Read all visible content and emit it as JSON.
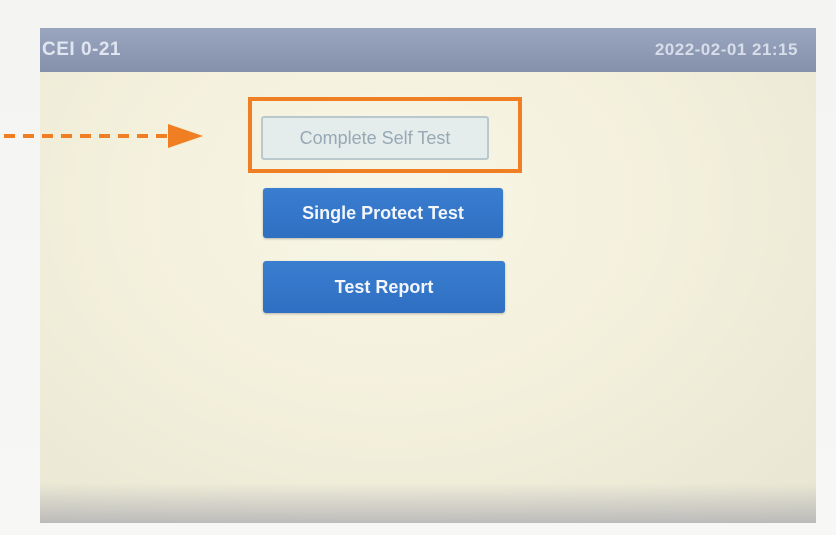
{
  "title_bar": {
    "left_text": "CEI 0-21",
    "datetime": "2022-02-01 21:15"
  },
  "menu": {
    "items": [
      {
        "label": "Complete Self Test",
        "state": "selected"
      },
      {
        "label": "Single Protect Test",
        "state": "normal"
      },
      {
        "label": "Test Report",
        "state": "normal"
      }
    ]
  },
  "annotation": {
    "highlight_color": "#f07f23",
    "pointer_icon": "dashed-arrow-right-icon"
  }
}
